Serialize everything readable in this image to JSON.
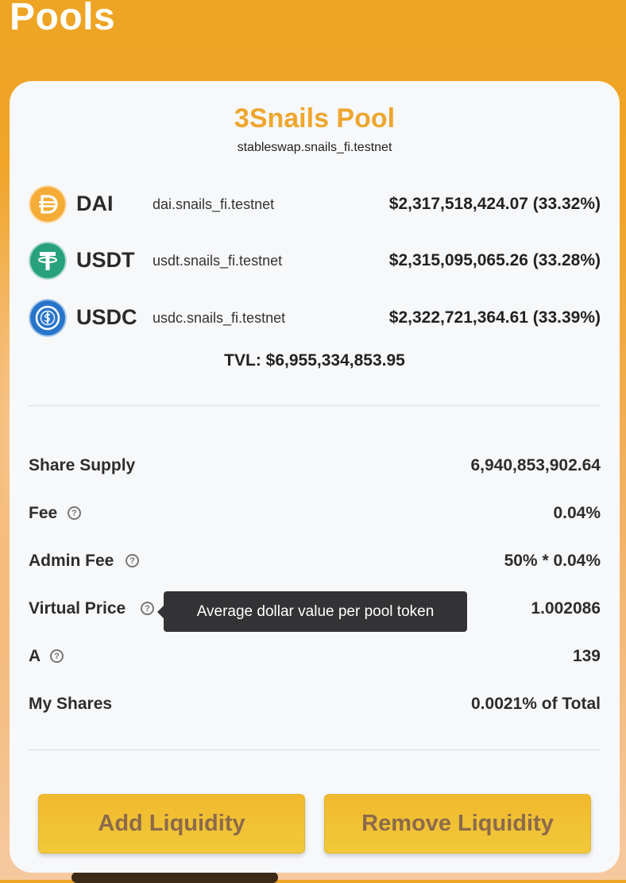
{
  "page": {
    "title": "Pools"
  },
  "pool": {
    "name": "3Snails Pool",
    "contract": "stableswap.snails_fi.testnet",
    "tokens": [
      {
        "symbol": "DAI",
        "address": "dai.snails_fi.testnet",
        "balance": "$2,317,518,424.07 (33.32%)",
        "icon": "dai-icon",
        "color": "#f5ac37"
      },
      {
        "symbol": "USDT",
        "address": "usdt.snails_fi.testnet",
        "balance": "$2,315,095,065.26 (33.28%)",
        "icon": "tether-icon",
        "color": "#26a17b"
      },
      {
        "symbol": "USDC",
        "address": "usdc.snails_fi.testnet",
        "balance": "$2,322,721,364.61 (33.39%)",
        "icon": "usdc-icon",
        "color": "#2775ca"
      }
    ],
    "tvl": "TVL: $6,955,334,853.95"
  },
  "stats": {
    "share_supply": {
      "label": "Share Supply",
      "value": "6,940,853,902.64"
    },
    "fee": {
      "label": "Fee",
      "value": "0.04%"
    },
    "admin_fee": {
      "label": "Admin Fee",
      "value": "50% * 0.04%"
    },
    "virtual_price": {
      "label": "Virtual Price",
      "value": "1.002086"
    },
    "a": {
      "label": "A",
      "value": "139"
    },
    "my_shares": {
      "label": "My Shares",
      "value": "0.0021% of Total"
    }
  },
  "tooltip": {
    "text": "Average dollar value per pool token"
  },
  "help_icon_glyph": "?",
  "actions": {
    "add_liquidity": "Add Liquidity",
    "remove_liquidity": "Remove Liquidity"
  },
  "colors": {
    "background": "#eea424",
    "accent": "#eea62f",
    "button": "#f1b92e",
    "button_text": "#8c6a4a"
  }
}
